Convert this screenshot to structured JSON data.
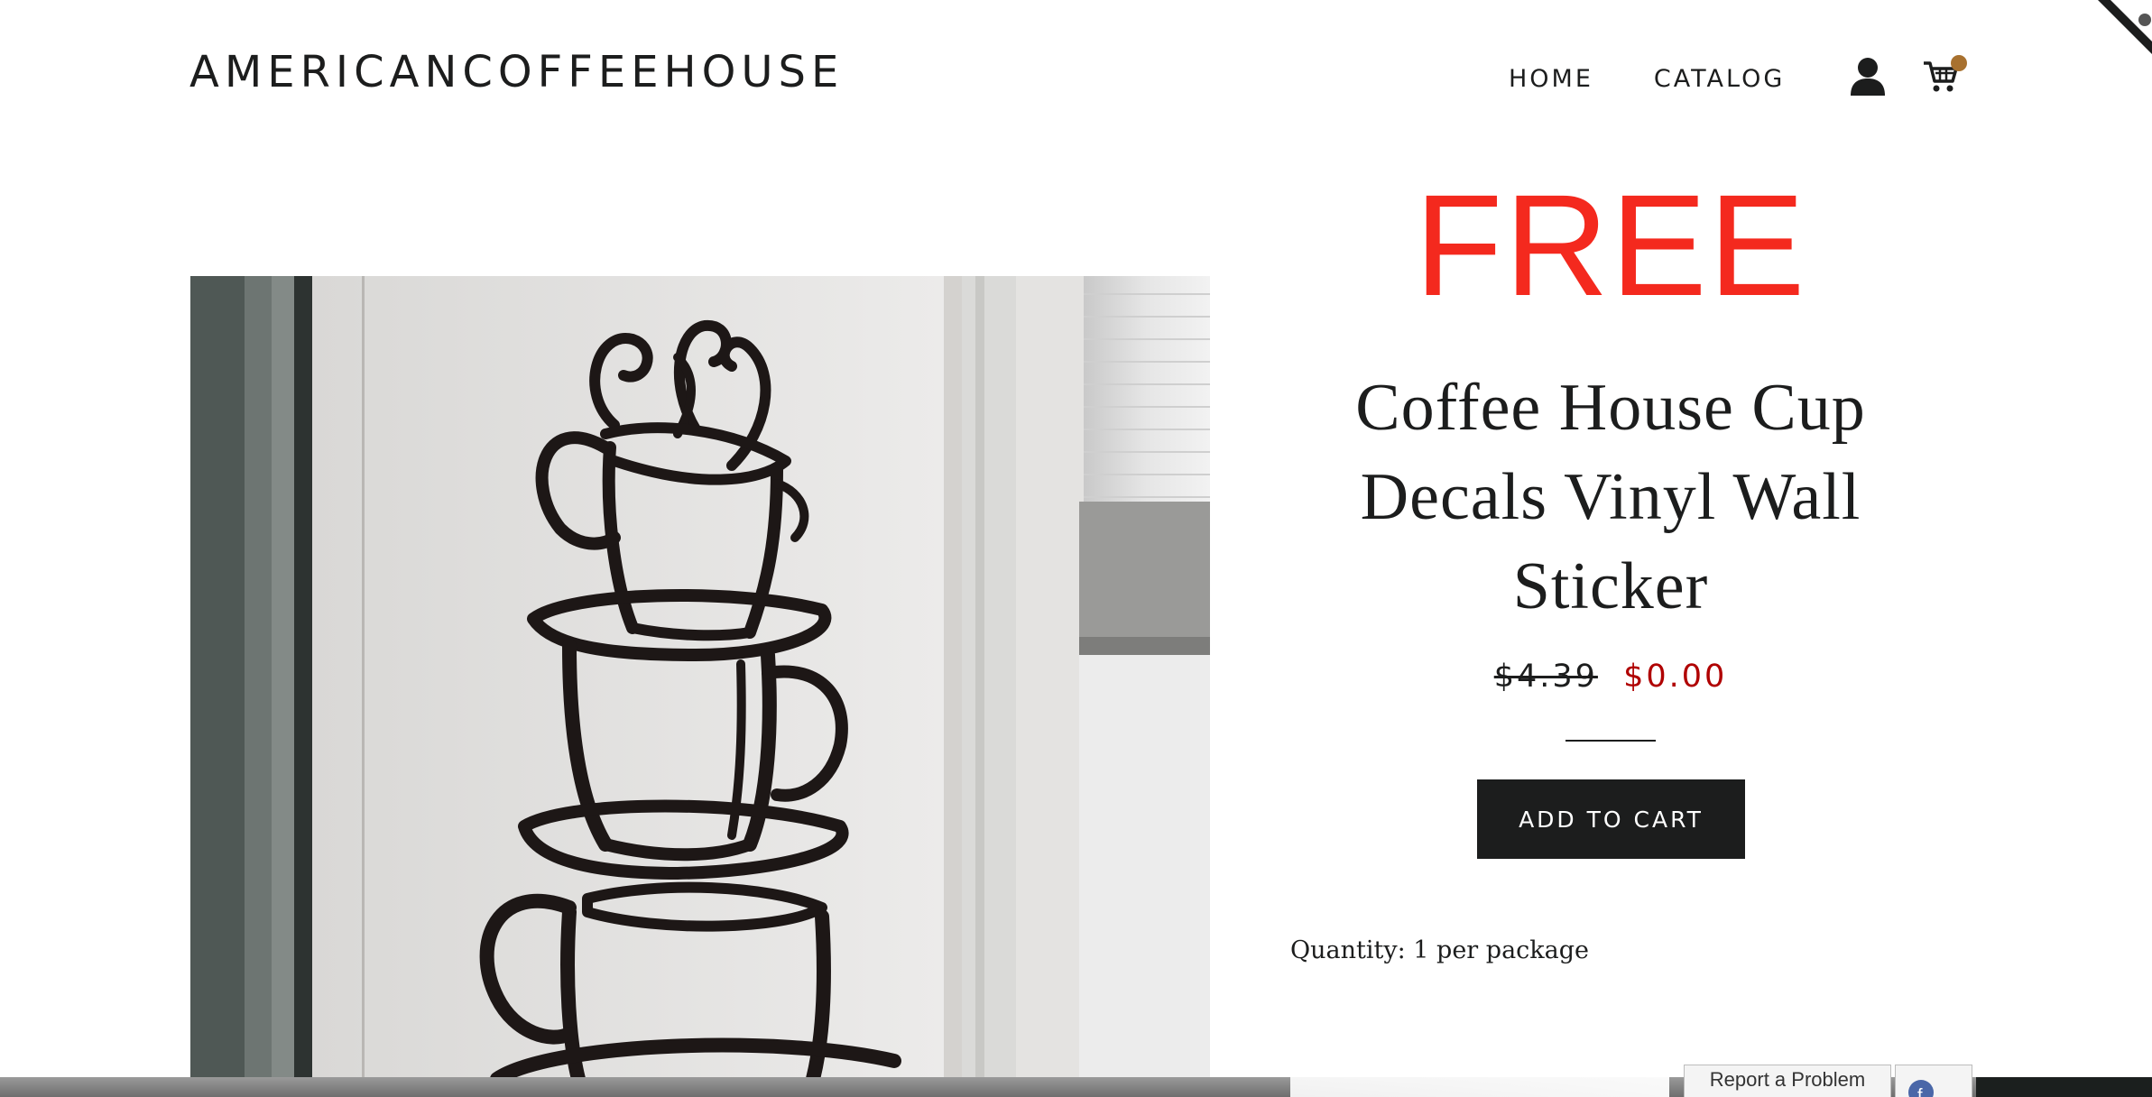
{
  "header": {
    "brand": "AMERICANCOFFEEHOUSE",
    "nav": [
      {
        "label": "HOME"
      },
      {
        "label": "CATALOG"
      }
    ],
    "icons": {
      "account": "user-icon",
      "cart": "cart-icon",
      "cart_badge_color": "#a8712f"
    }
  },
  "product": {
    "badge": "FREE",
    "badge_color": "#f4291e",
    "title": "Coffee House Cup Decals Vinyl Wall Sticker",
    "compare_price": "$4.39",
    "sale_price": "$0.00",
    "sale_color": "#b00000",
    "add_to_cart_label": "ADD TO CART",
    "quantity_text": "Quantity: 1 per package"
  },
  "footer_bar": {
    "report_label": "Report a Problem"
  }
}
